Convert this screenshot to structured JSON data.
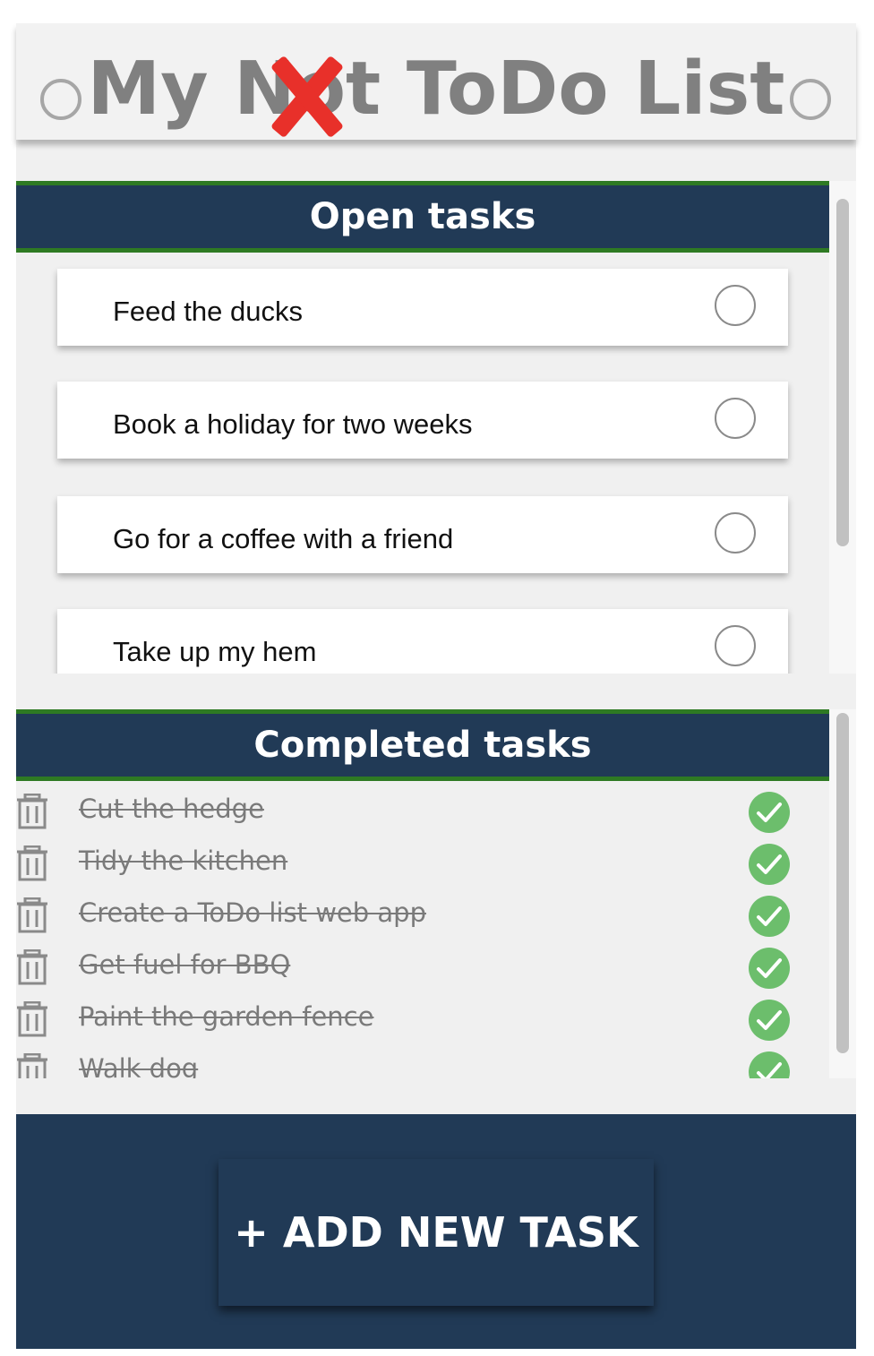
{
  "header": {
    "title_prefix": "My ",
    "title_struck_word": "Not",
    "title_suffix": " ToDo List"
  },
  "open_section": {
    "title": "Open tasks",
    "tasks": [
      {
        "label": "Feed the ducks"
      },
      {
        "label": "Book a holiday for two weeks"
      },
      {
        "label": "Go for a coffee with a friend"
      },
      {
        "label": "Take up my hem"
      }
    ]
  },
  "completed_section": {
    "title": "Completed tasks",
    "tasks": [
      {
        "label": "Cut the hedge"
      },
      {
        "label": "Tidy the kitchen"
      },
      {
        "label": "Create a ToDo list web app"
      },
      {
        "label": "Get fuel for BBQ"
      },
      {
        "label": "Paint the garden fence"
      },
      {
        "label": "Walk dog"
      }
    ]
  },
  "footer": {
    "add_button_label": "+ ADD NEW TASK"
  },
  "colors": {
    "navy": "#213a56",
    "green_border": "#2e7a23",
    "check_green": "#6cbe6c",
    "cross_red": "#e8302a"
  },
  "icons": {
    "header_left": "ring-hole-icon",
    "header_right": "ring-hole-icon",
    "title_mark": "red-cross-icon",
    "open_task_action": "empty-circle-checkbox-icon",
    "completed_delete": "trash-icon",
    "completed_status": "green-checkmark-icon"
  }
}
